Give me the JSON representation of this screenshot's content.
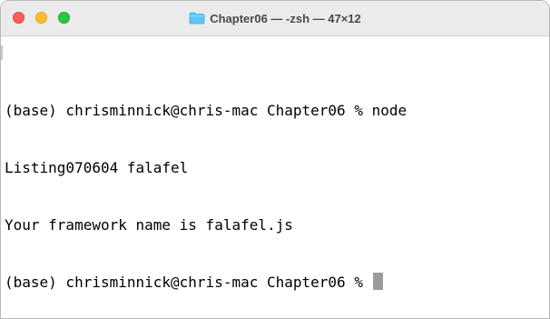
{
  "window": {
    "title": "Chapter06 — -zsh — 47×12",
    "folder_icon": "folder-icon",
    "buttons": [
      "close-button",
      "minimize-button",
      "zoom-button"
    ],
    "colors": {
      "close": "#ff5f57",
      "minimize": "#febc2e",
      "zoom": "#28c840",
      "folder": "#5ac8f5"
    }
  },
  "terminal": {
    "lines": [
      "(base) chrisminnick@chris-mac Chapter06 % node",
      "Listing070604 falafel",
      "Your framework name is falafel.js",
      "(base) chrisminnick@chris-mac Chapter06 % "
    ],
    "cursor": "block"
  }
}
